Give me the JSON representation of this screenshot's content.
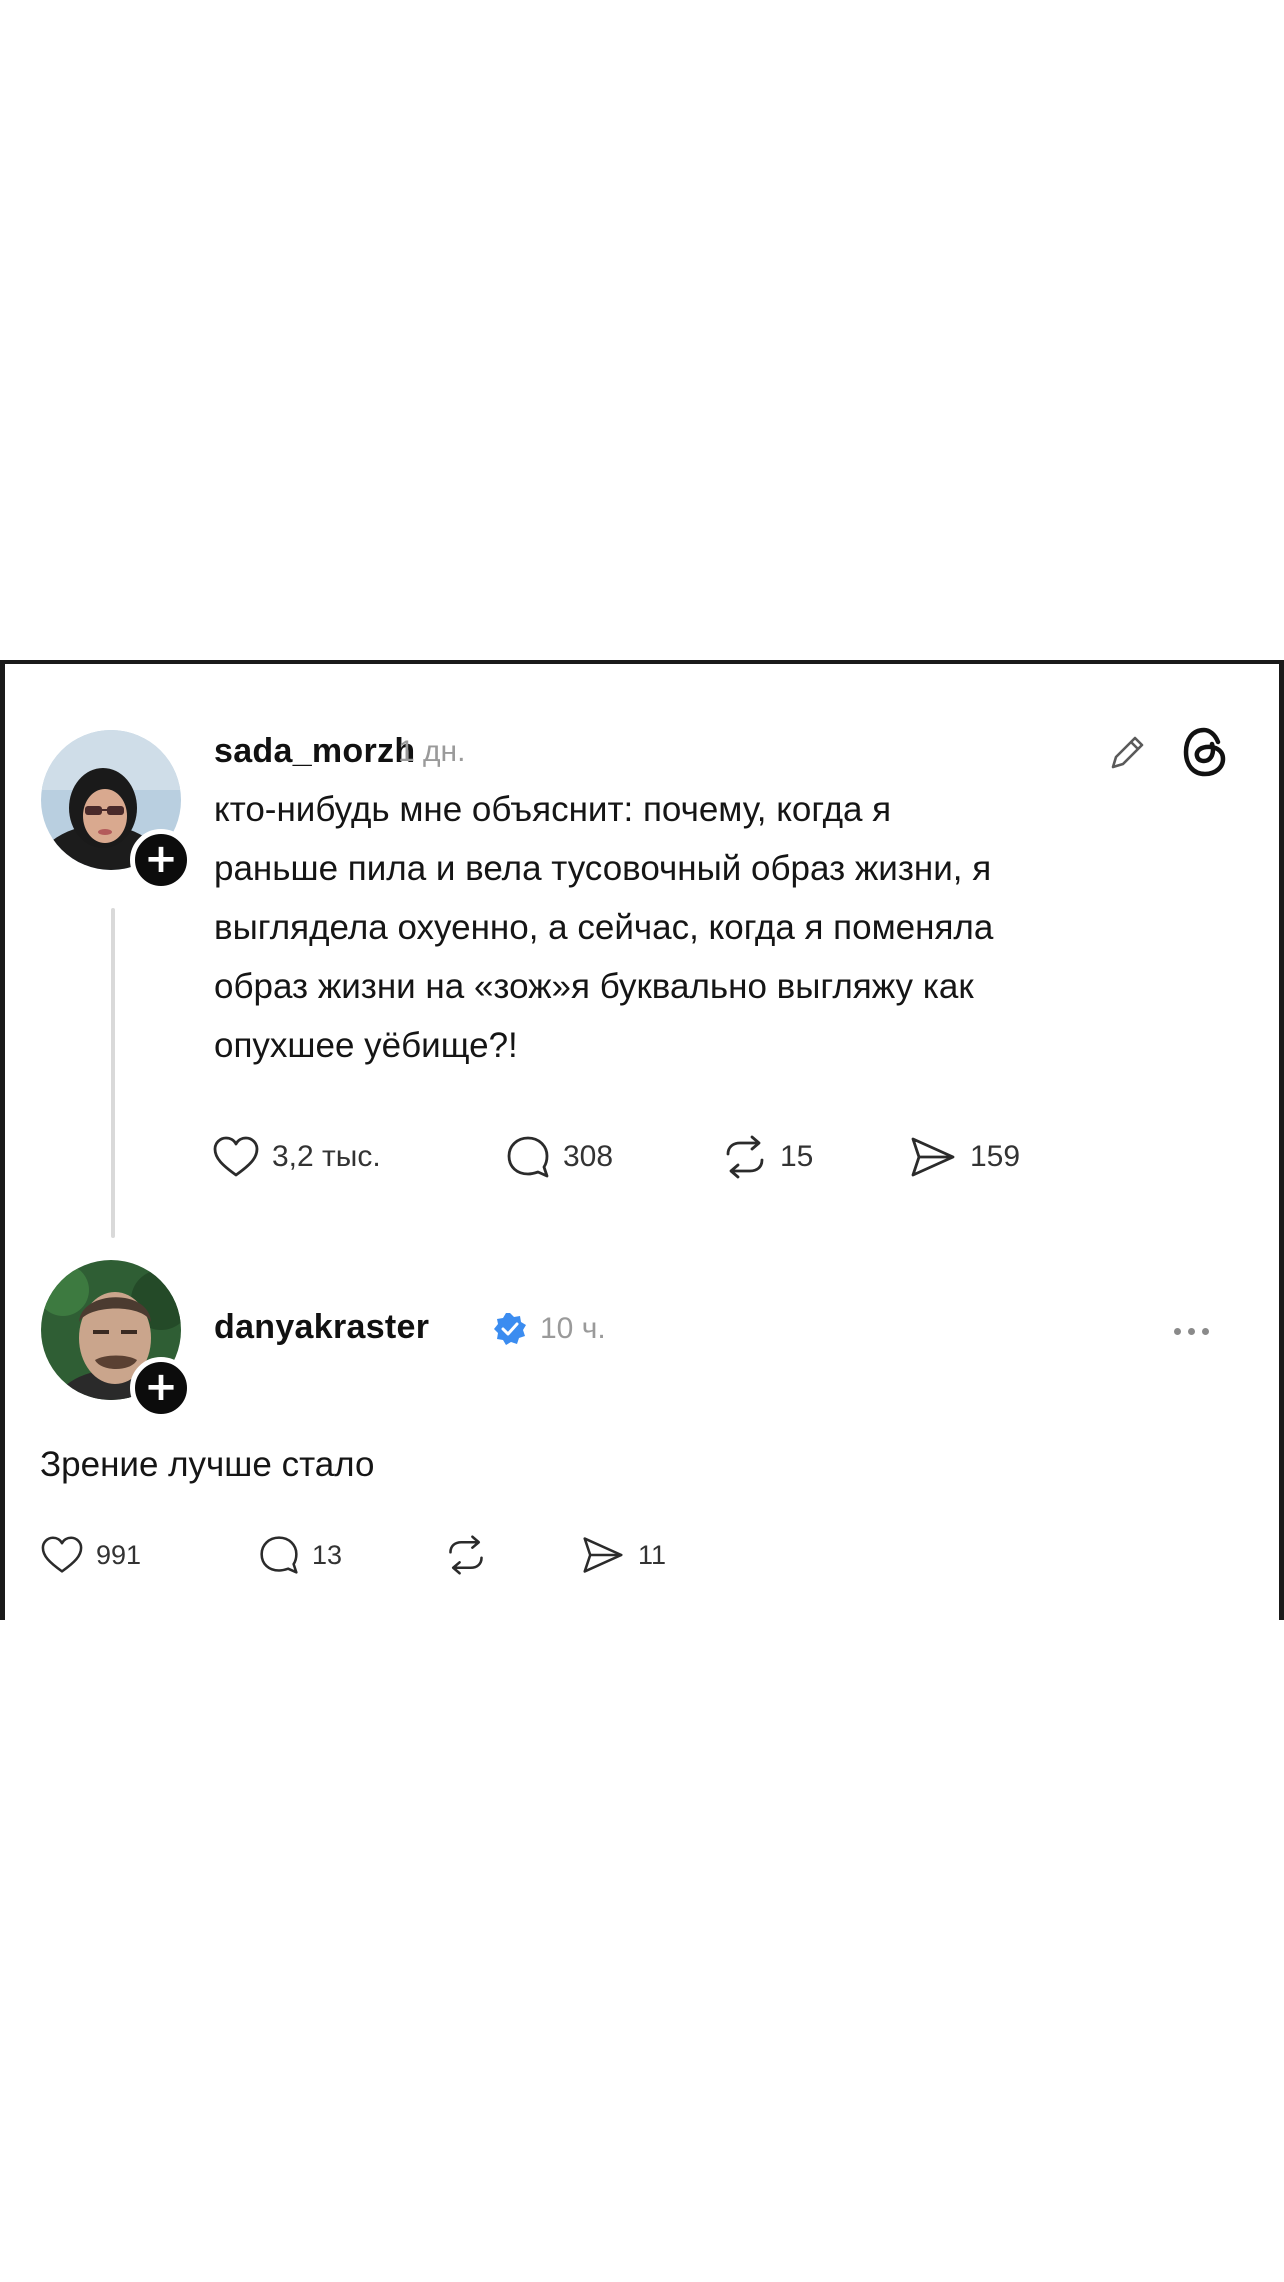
{
  "post": {
    "username": "sada_morzh",
    "time": "1 дн.",
    "text_lines": [
      "кто-нибудь мне объяснит: почему, когда я",
      "раньше пила и вела тусовочный образ жизни, я",
      "выглядела охуенно, а сейчас, когда я поменяла",
      "образ жизни на «зож»я буквально выгляжу как",
      "опухшее уёбище?!"
    ],
    "likes": "3,2 тыс.",
    "comments": "308",
    "reposts": "15",
    "shares": "159",
    "icons": {
      "avatar": "user-avatar",
      "follow": "plus-icon",
      "edit": "pencil-icon",
      "app": "threads-logo-icon",
      "like": "heart-icon",
      "comment": "speech-bubble-icon",
      "repost": "repost-arrows-icon",
      "share": "paper-plane-icon"
    }
  },
  "reply": {
    "username": "danyakraster",
    "time": "10 ч.",
    "text": "Зрение лучше стало",
    "likes": "991",
    "comments": "13",
    "reposts": "",
    "shares": "11",
    "icons": {
      "avatar": "user-avatar",
      "verified": "verified-badge-icon",
      "more": "more-dots-icon"
    }
  },
  "colors": {
    "text": "#111111",
    "muted": "#9a9a9a",
    "verified": "#3b8cf0",
    "frame": "#1a1a1a"
  }
}
